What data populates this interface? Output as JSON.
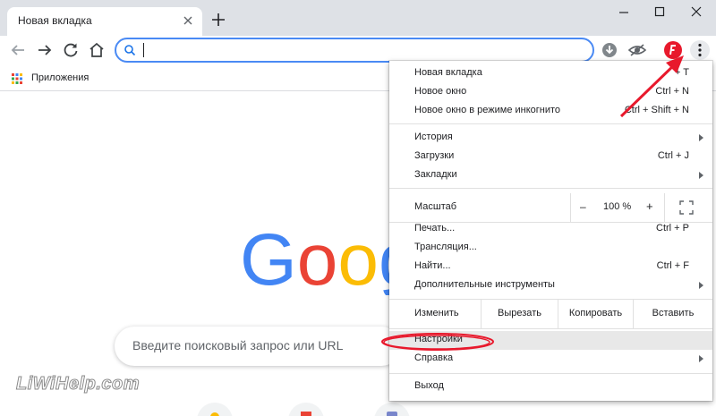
{
  "tab": {
    "title": "Новая вкладка"
  },
  "omnibox": {
    "value": ""
  },
  "bookmarks": {
    "apps_label": "Приложения"
  },
  "page": {
    "search_placeholder": "Введите поисковый запрос или URL",
    "logo_text": "Goog",
    "watermark": "LiWiHelp.com"
  },
  "menu": {
    "items_top": [
      {
        "label": "Новая вкладка",
        "shortcut": "+ T"
      },
      {
        "label": "Новое окно",
        "shortcut": "Ctrl + N"
      },
      {
        "label": "Новое окно в режиме инкогнито",
        "shortcut": "Ctrl + Shift + N"
      }
    ],
    "items_history": [
      {
        "label": "История",
        "shortcut": ""
      },
      {
        "label": "Загрузки",
        "shortcut": "Ctrl + J"
      },
      {
        "label": "Закладки",
        "shortcut": ""
      }
    ],
    "zoom": {
      "label": "Масштаб",
      "minus": "–",
      "value": "100 %",
      "plus": "+"
    },
    "items_tools": [
      {
        "label": "Печать...",
        "shortcut": "Ctrl + P"
      },
      {
        "label": "Трансляция...",
        "shortcut": ""
      },
      {
        "label": "Найти...",
        "shortcut": "Ctrl + F"
      },
      {
        "label": "Дополнительные инструменты",
        "shortcut": ""
      }
    ],
    "edit": {
      "label": "Изменить",
      "cut": "Вырезать",
      "copy": "Копировать",
      "paste": "Вставить"
    },
    "settings": "Настройки",
    "help": "Справка",
    "exit": "Выход"
  },
  "colors": {
    "accent_blue": "#4a8af4",
    "annotation_red": "#e8192c",
    "google_blue": "#4285f4",
    "google_red": "#ea4335",
    "google_yellow": "#fbbc05"
  }
}
